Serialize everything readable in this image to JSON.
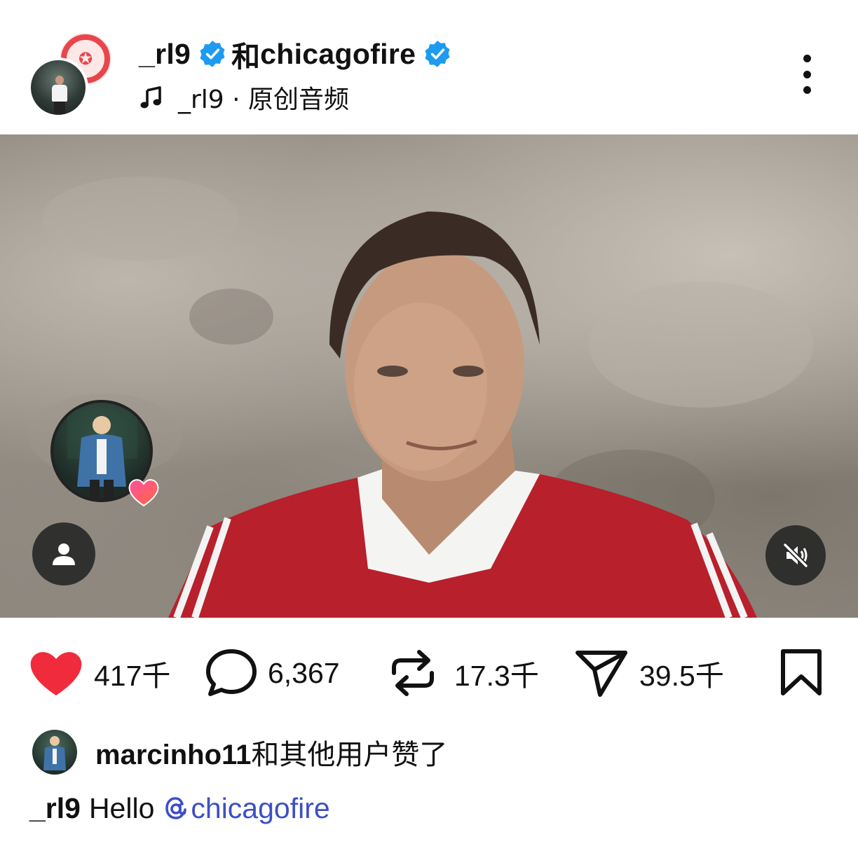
{
  "header": {
    "account1": "_rl9",
    "connector": "和",
    "account2": "chicagofire",
    "audio_label": "_rl9 · 原创音频",
    "icons": [
      "club-logo",
      "verified-badge-icon",
      "music-note-icon",
      "more-vertical-icon"
    ]
  },
  "media": {
    "icons": [
      "user-tag-icon",
      "mute-icon",
      "heart-icon"
    ]
  },
  "actions": {
    "likes": "417",
    "likes_unit": "千",
    "comments": "6,367",
    "reposts": "17.3",
    "reposts_unit": "千",
    "shares": "39.5",
    "shares_unit": "千",
    "colors": {
      "like": "#f02b3c",
      "accent": "#1d9bf0"
    }
  },
  "liked_by": {
    "name": "marcinho11",
    "suffix": "和其他用户赞了"
  },
  "caption": {
    "author": "_rl9",
    "text": "Hello",
    "mention": "chicagofire"
  }
}
